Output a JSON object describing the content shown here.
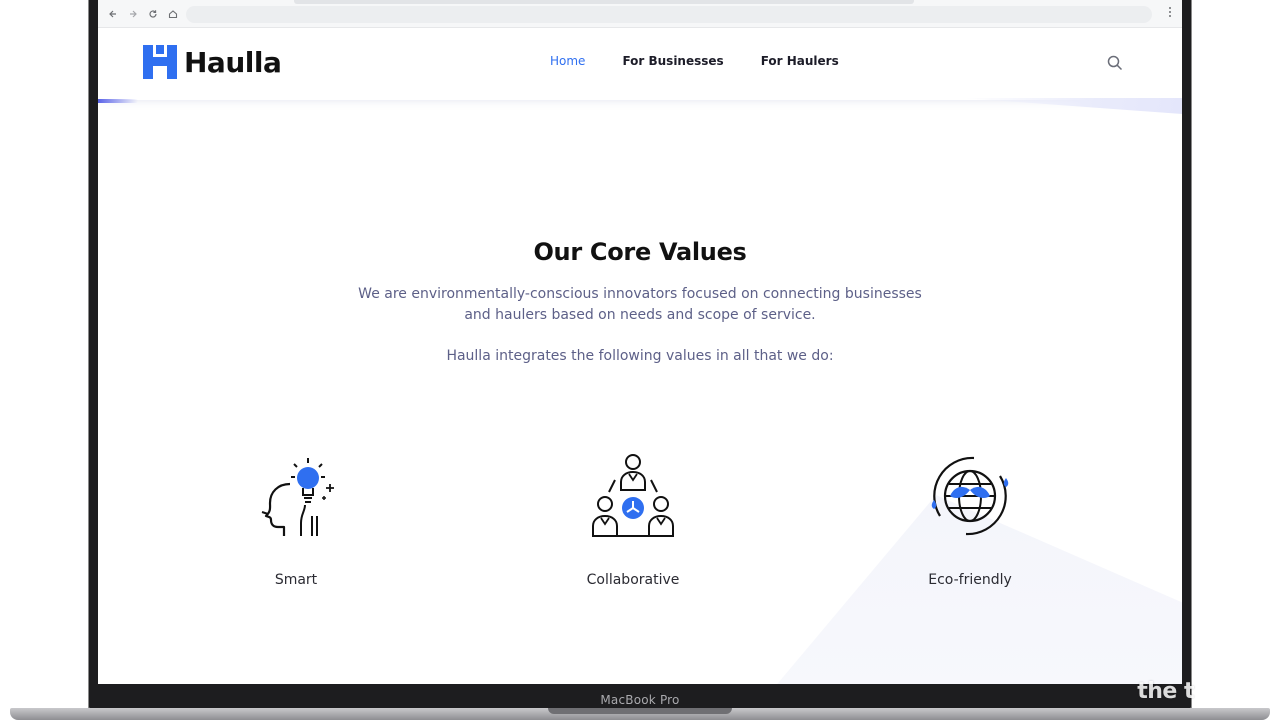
{
  "device": {
    "model_label": "MacBook Pro"
  },
  "browser": {
    "back_icon": "arrow-left-icon",
    "forward_icon": "arrow-right-icon",
    "reload_icon": "reload-icon",
    "home_icon": "home-icon",
    "menu_icon": "kebab-menu-icon",
    "address": ""
  },
  "site": {
    "logo_text": "Haulla",
    "brand_color": "#2f6ff0",
    "nav": [
      {
        "label": "Home",
        "active": true
      },
      {
        "label": "For Businesses",
        "active": false
      },
      {
        "label": "For Haulers",
        "active": false
      }
    ],
    "search_icon": "search-icon"
  },
  "core_values": {
    "title": "Our Core Values",
    "description": "We are environmentally-conscious innovators focused on connecting businesses and haulers based on needs and scope of service.",
    "intro": "Haulla integrates the following values in all that we do:",
    "items": [
      {
        "label": "Smart",
        "icon": "head-lightbulb-icon"
      },
      {
        "label": "Collaborative",
        "icon": "team-network-icon"
      },
      {
        "label": "Eco-friendly",
        "icon": "globe-leaves-icon"
      }
    ]
  },
  "watermark": "the t"
}
